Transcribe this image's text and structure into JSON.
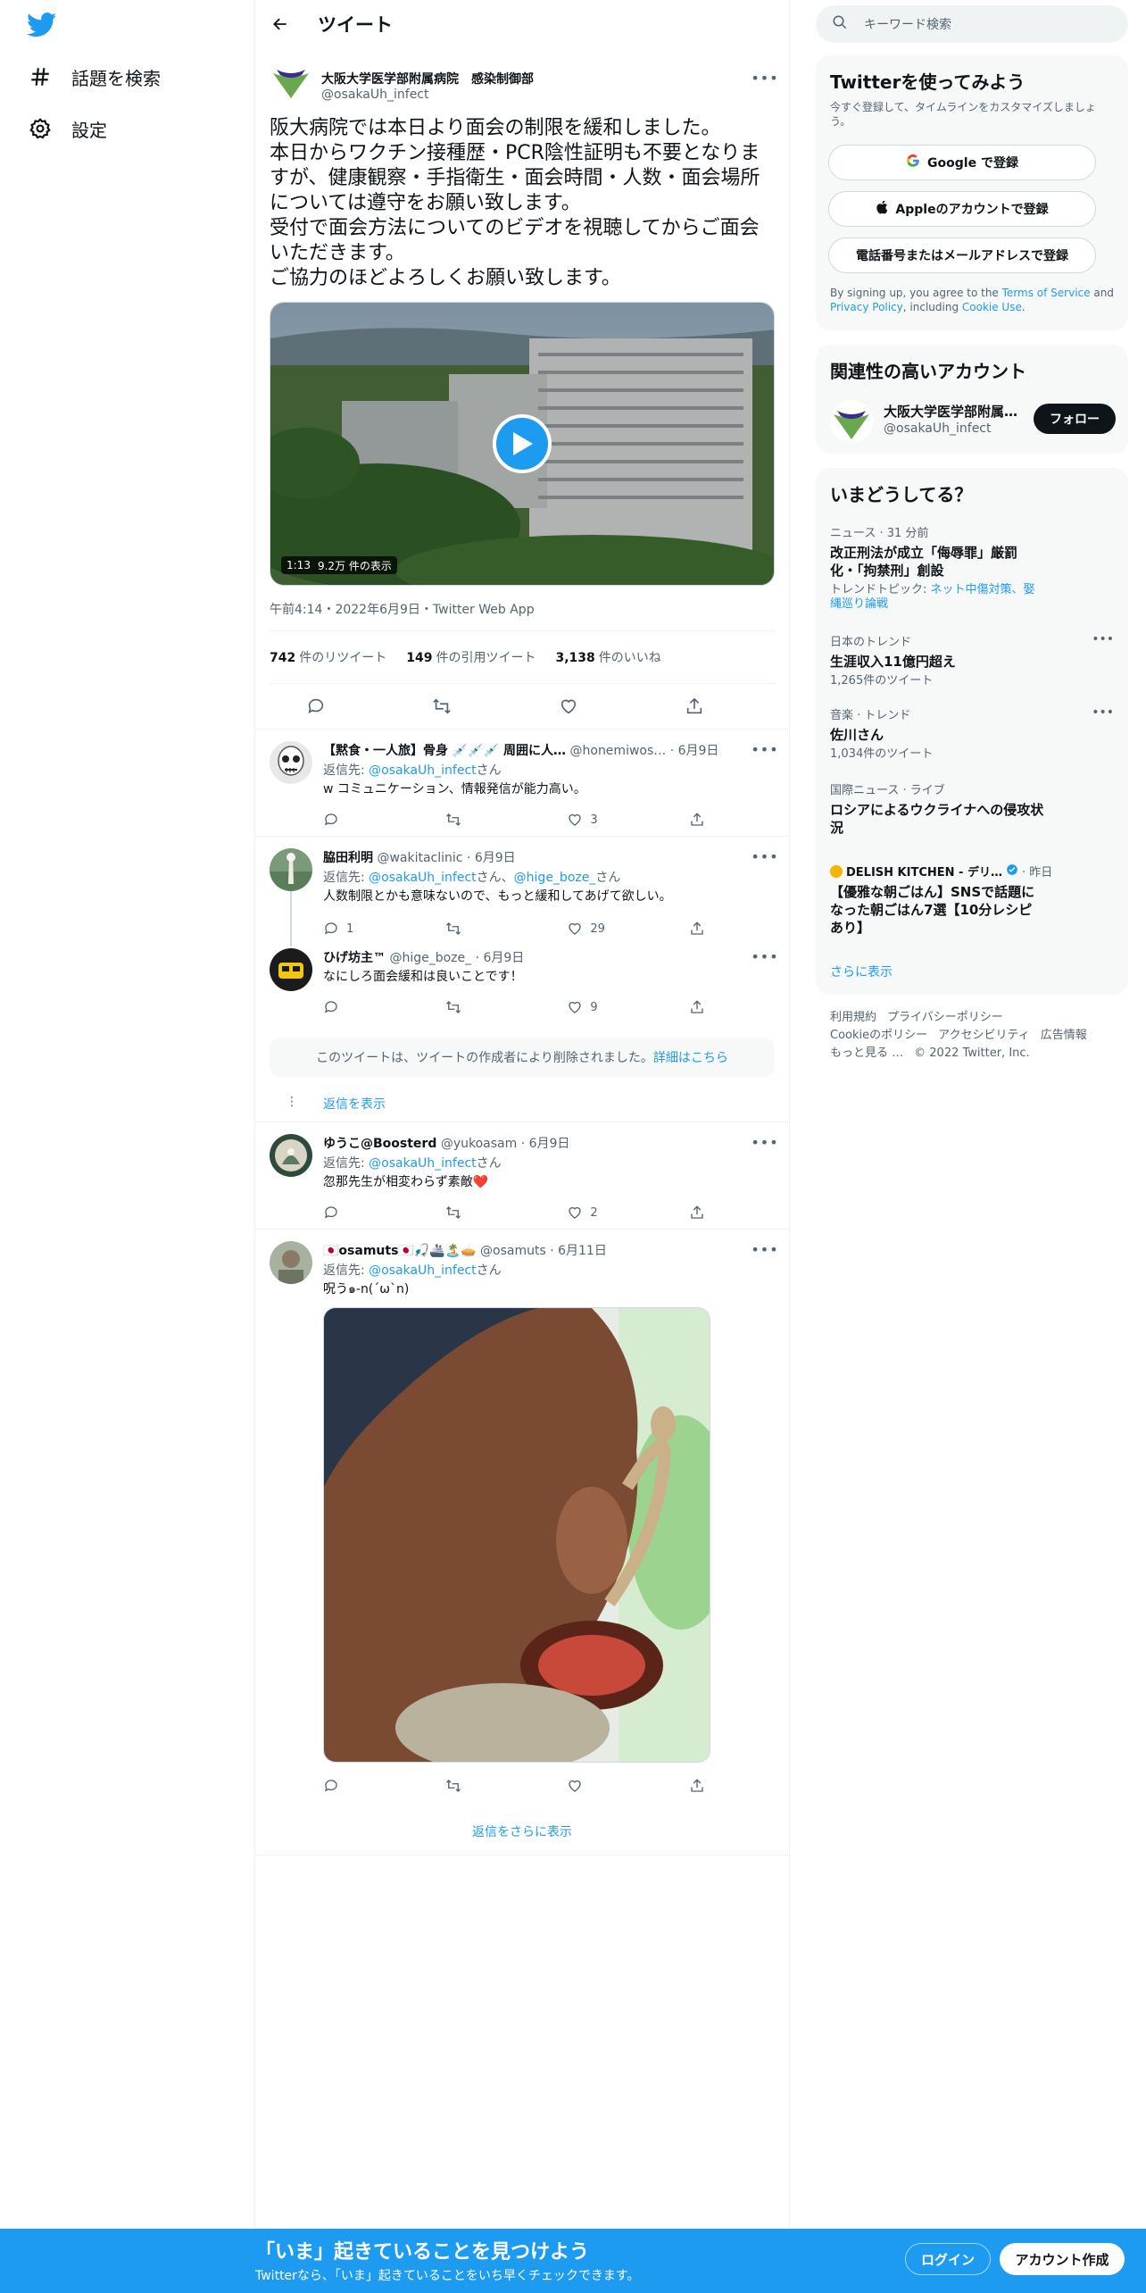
{
  "nav": {
    "explore_label": "話題を検索",
    "settings_label": "設定"
  },
  "header": {
    "title": "ツイート"
  },
  "main_tweet": {
    "name": "大阪大学医学部附属病院　感染制御部",
    "handle": "@osakaUh_infect",
    "text": "阪大病院では本日より面会の制限を緩和しました。\n本日からワクチン接種歴・PCR陰性証明も不要となりますが、健康観察・手指衛生・面会時間・人数・面会場所については遵守をお願い致します。\n受付で面会方法についてのビデオを視聴してからご面会いただきます。\nご協力のほどよろしくお願い致します。",
    "video_duration": "1:13",
    "video_views": "9.2万 件の表示",
    "timestamp": "午前4:14・2022年6月9日・Twitter Web App",
    "retweets_count": "742",
    "retweets_label": "件のリツイート",
    "quotes_count": "149",
    "quotes_label": "件の引用ツイート",
    "likes_count": "3,138",
    "likes_label": "件のいいね"
  },
  "replies": [
    {
      "name": "【黙食・一人旅】骨身 💉💉💉 周囲に人…",
      "handle": "@honemiwos…",
      "date": "· 6月9日",
      "to_prefix": "返信先: ",
      "to": "@osakaUh_infect",
      "to_suffix": "さん",
      "text": "w コミュニケーション、情報発信が能力高い。",
      "likes": "3"
    },
    {
      "name": "脇田利明",
      "handle": "@wakitaclinic",
      "date": "· 6月9日",
      "to_prefix": "返信先: ",
      "to": "@osakaUh_infect",
      "to_mid": "さん、",
      "to2": "@hige_boze_",
      "to_suffix": "さん",
      "text": "人数制限とかも意味ないので、もっと緩和してあげて欲しい。",
      "replies": "1",
      "likes": "29"
    },
    {
      "name": "ひげ坊主™",
      "handle": "@hige_boze_",
      "date": "· 6月9日",
      "text": "なにしろ面会緩和は良いことです！",
      "likes": "9"
    },
    {
      "name": "ゆうこ@Boosterd",
      "handle": "@yukoasam",
      "date": "· 6月9日",
      "to_prefix": "返信先: ",
      "to": "@osakaUh_infect",
      "to_suffix": "さん",
      "text": "忽那先生が相変わらず素敵❤️",
      "likes": "2"
    },
    {
      "name": "🇯🇵osamuts🇯🇵🎣🚢🏝️🥧",
      "handle": "@osamuts",
      "date": "· 6月11日",
      "to_prefix": "返信先: ",
      "to": "@osakaUh_infect",
      "to_suffix": "さん",
      "text": "呪う๑-n(ˊωˋn)"
    }
  ],
  "deleted_notice": "このツイートは、ツイートの作成者により削除されました。",
  "deleted_link": "詳細はこちら",
  "show_replies_label": "返信を表示",
  "more_replies_label": "返信をさらに表示",
  "search": {
    "placeholder": "キーワード検索"
  },
  "signup_panel": {
    "title": "Twitterを使ってみよう",
    "subtitle": "今すぐ登録して、タイムラインをカスタマイズしましょう。",
    "google_label": "Google で登録",
    "apple_label": "Appleのアカウントで登録",
    "phone_label": "電話番号またはメールアドレスで登録",
    "terms_prefix": "By signing up, you agree to the ",
    "terms_link": "Terms of Service",
    "terms_and": " and ",
    "privacy_link": "Privacy Policy",
    "terms_mid": ", including ",
    "cookie_link": "Cookie Use",
    "terms_end": "."
  },
  "related_panel": {
    "title": "関連性の高いアカウント",
    "name": "大阪大学医学部附属…",
    "handle": "@osakaUh_infect",
    "follow_label": "フォロー"
  },
  "trends_panel": {
    "title": "いまどうしてる？",
    "items": [
      {
        "meta": "ニュース · 31 分前",
        "title": "改正刑法が成立「侮辱罪」厳罰化・「拘禁刑」創設",
        "sub_prefix": "トレンドトピック: ",
        "sub_link": "ネット中傷対策、娶縄巡り論戦"
      },
      {
        "meta": "日本のトレンド",
        "title": "生涯収入11億円超え",
        "sub": "1,265件のツイート"
      },
      {
        "meta": "音楽 · トレンド",
        "title": "佐川さん",
        "sub": "1,034件のツイート"
      },
      {
        "meta": "国際ニュース · ライブ",
        "title": "ロシアによるウクライナへの侵攻状況"
      },
      {
        "meta": "DELISH KITCHEN - デリ…",
        "meta_suffix": "· 昨日",
        "title": "【優雅な朝ごはん】SNSで話題になった朝ごはん7選【10分レシピあり】"
      }
    ],
    "more_label": "さらに表示"
  },
  "footer": {
    "links": [
      "利用規約",
      "プライバシーポリシー",
      "Cookieのポリシー",
      "アクセシビリティ",
      "広告情報",
      "もっと見る …"
    ],
    "copyright": "© 2022 Twitter, Inc."
  },
  "bottom_bar": {
    "headline": "「いま」起きていることを見つけよう",
    "subline": "Twitterなら、「いま」起きていることをいち早くチェックできます。",
    "login_label": "ログイン",
    "signup_label": "アカウント作成"
  },
  "colors": {
    "accent": "#1d9bf0",
    "text": "#0f1419",
    "muted": "#536471",
    "like_heart": "#e0245e"
  }
}
